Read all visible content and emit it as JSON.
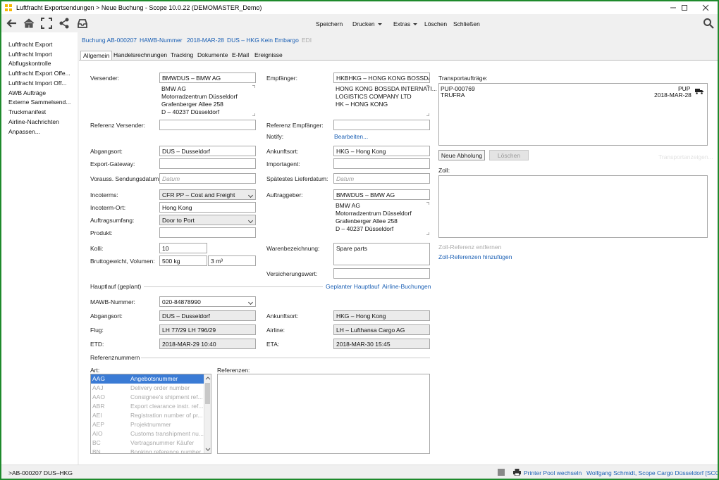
{
  "window": {
    "title": "Luftfracht Exportsendungen > Neue Buchung - Scope 10.0.22 (DEMOMASTER_Demo)"
  },
  "toolbar": {
    "save": "Speichern",
    "print": "Drucken",
    "extras": "Extras",
    "delete": "Löschen",
    "close": "Schließen"
  },
  "sidebar": {
    "items": [
      "Luftfracht Export",
      "Luftfracht Import",
      "Abflugskontrolle",
      "Luftfracht Export Offe...",
      "Luftfracht Import Off...",
      "AWB Aufträge",
      "Externe Sammelsend...",
      "Truckmanifest",
      "Airline-Nachrichten",
      "Anpassen..."
    ]
  },
  "breadcrumbs": {
    "booking": "Buchung AB-000207",
    "hawb": "HAWB-Nummer",
    "date": "2018-MAR-28",
    "route": "DUS – HKG",
    "embargo": "Kein Embargo",
    "edi": "EDI"
  },
  "tabs": [
    "Allgemein",
    "Handelsrechnungen",
    "Tracking",
    "Dokumente",
    "E-Mail",
    "Ereignisse"
  ],
  "form": {
    "shipper_label": "Versender:",
    "shipper_value": "BMWDUS – BMW AG",
    "shipper_addr": [
      "BMW AG",
      "Motorradzentrum Düsseldorf",
      "Grafenberger Allee 258",
      "D – 40237 Düsseldorf"
    ],
    "consignee_label": "Empfänger:",
    "consignee_value": "HKBHKG – HONG KONG BOSSDA INT",
    "consignee_addr": [
      "HONG KONG BOSSDA INTERNATI...",
      "LOGISTICS COMPANY LTD",
      "HK – HONG KONG"
    ],
    "ref_shipper_label": "Referenz Versender:",
    "ref_consignee_label": "Referenz Empfänger:",
    "notify_label": "Notify:",
    "notify_link": "Bearbeiten...",
    "origin_label": "Abgangsort:",
    "origin_value": "DUS – Dusseldorf",
    "dest_label": "Ankunftsort:",
    "dest_value": "HKG – Hong Kong",
    "export_gw_label": "Export-Gateway:",
    "import_agent_label": "Importagent:",
    "ship_date_label": "Vorauss. Sendungsdatum:",
    "ship_date_placeholder": "Datum",
    "latest_delivery_label": "Spätestes Lieferdatum:",
    "latest_delivery_placeholder": "Datum",
    "incoterms_label": "Incoterms:",
    "incoterms_value": "CFR PP – Cost and Freight",
    "client_label": "Auftraggeber:",
    "client_value": "BMWDUS – BMW AG",
    "client_addr": [
      "BMW AG",
      "Motorradzentrum Düsseldorf",
      "Grafenberger Allee 258",
      "D – 40237 Düsseldorf"
    ],
    "incoterm_place_label": "Incoterm-Ort:",
    "incoterm_place_value": "Hong Kong",
    "scope_label": "Auftragsumfang:",
    "scope_value": "Door to Port",
    "product_label": "Produkt:",
    "pieces_label": "Kolli:",
    "pieces_value": "10",
    "goods_label": "Warenbezeichnung:",
    "goods_value": "Spare parts",
    "weight_label": "Bruttogewicht, Volumen:",
    "weight_value": "500 kg",
    "volume_value": "3 m³",
    "insurance_label": "Versicherungswert:"
  },
  "mainhaul": {
    "section_label": "Hauptlauf (geplant)",
    "link_planned": "Geplanter Hauptlauf",
    "link_airline": "Airline-Buchungen",
    "mawb_label": "MAWB-Nummer:",
    "mawb_value": "020-84878990",
    "origin_label": "Abgangsort:",
    "origin_value": "DUS – Dusseldorf",
    "dest_label": "Ankunftsort:",
    "dest_value": "HKG – Hong Kong",
    "flight_label": "Flug:",
    "flight_value": "LH 77/29 LH 796/29",
    "airline_label": "Airline:",
    "airline_value": "LH – Lufthansa Cargo AG",
    "etd_label": "ETD:",
    "etd_value": "2018-MAR-29 10:40",
    "eta_label": "ETA:",
    "eta_value": "2018-MAR-30 15:45"
  },
  "references": {
    "section_label": "Referenznummern",
    "type_label": "Art:",
    "refs_label": "Referenzen:",
    "types": [
      {
        "code": "AAG",
        "name": "Angebotsnummer"
      },
      {
        "code": "AAJ",
        "name": "Delivery order number"
      },
      {
        "code": "AAO",
        "name": "Consignee's shipment ref..."
      },
      {
        "code": "ABR",
        "name": "Export clearance instr. ref..."
      },
      {
        "code": "AEI",
        "name": "Registration number of pr..."
      },
      {
        "code": "AEP",
        "name": "Projektnummer"
      },
      {
        "code": "AIO",
        "name": "Customs transhipment nu..."
      },
      {
        "code": "BC",
        "name": "Vertragsnummer Käufer"
      },
      {
        "code": "BN",
        "name": "Booking reference number"
      }
    ]
  },
  "transport": {
    "label": "Transportaufträge:",
    "order_id": "PUP-000769",
    "order_type": "PUP",
    "order_party": "TRUFRA",
    "order_date": "2018-MAR-28",
    "btn_new": "Neue Abholung",
    "btn_delete": "Löschen",
    "faded": "Transportanzeigen..."
  },
  "customs": {
    "label": "Zoll:",
    "remove_link": "Zoll-Referenz entfernen",
    "add_link": "Zoll-Referenzen hinzufügen"
  },
  "status": {
    "left": ">AB-000207 DUS–HKG",
    "printer": "Printer Pool wechseln",
    "user": "Wolfgang Schmidt, Scope Cargo Düsseldorf [SCO]"
  }
}
